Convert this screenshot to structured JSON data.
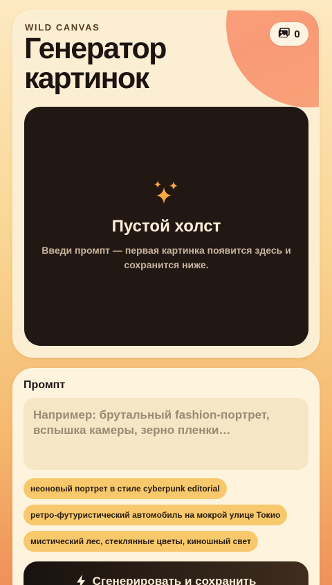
{
  "header": {
    "brand": "WILD CANVAS",
    "title": "Генератор картинок",
    "gallery_count": "0"
  },
  "canvas": {
    "title": "Пустой холст",
    "description": "Введи промпт — первая картинка появится здесь и сохранится ниже."
  },
  "prompt": {
    "label": "Промпт",
    "value": "",
    "placeholder": "Например: брутальный fashion-портрет, вспышка камеры, зерно пленки…",
    "suggestions": [
      "неоновый портрет в стиле cyberpunk editorial",
      "ретро-футуристический автомобиль на мокрой улице Токио",
      "мистический лес, стеклянные цветы, киношный свет"
    ],
    "generate_label": "Сгенерировать и сохранить"
  },
  "icons": {
    "gallery": "images-icon",
    "sparkle": "sparkles-icon",
    "generate": "bolt-icon"
  },
  "colors": {
    "accent": "#f7a845",
    "dark": "#221813",
    "chip": "#f7c96c",
    "blob": "#f99a76"
  }
}
